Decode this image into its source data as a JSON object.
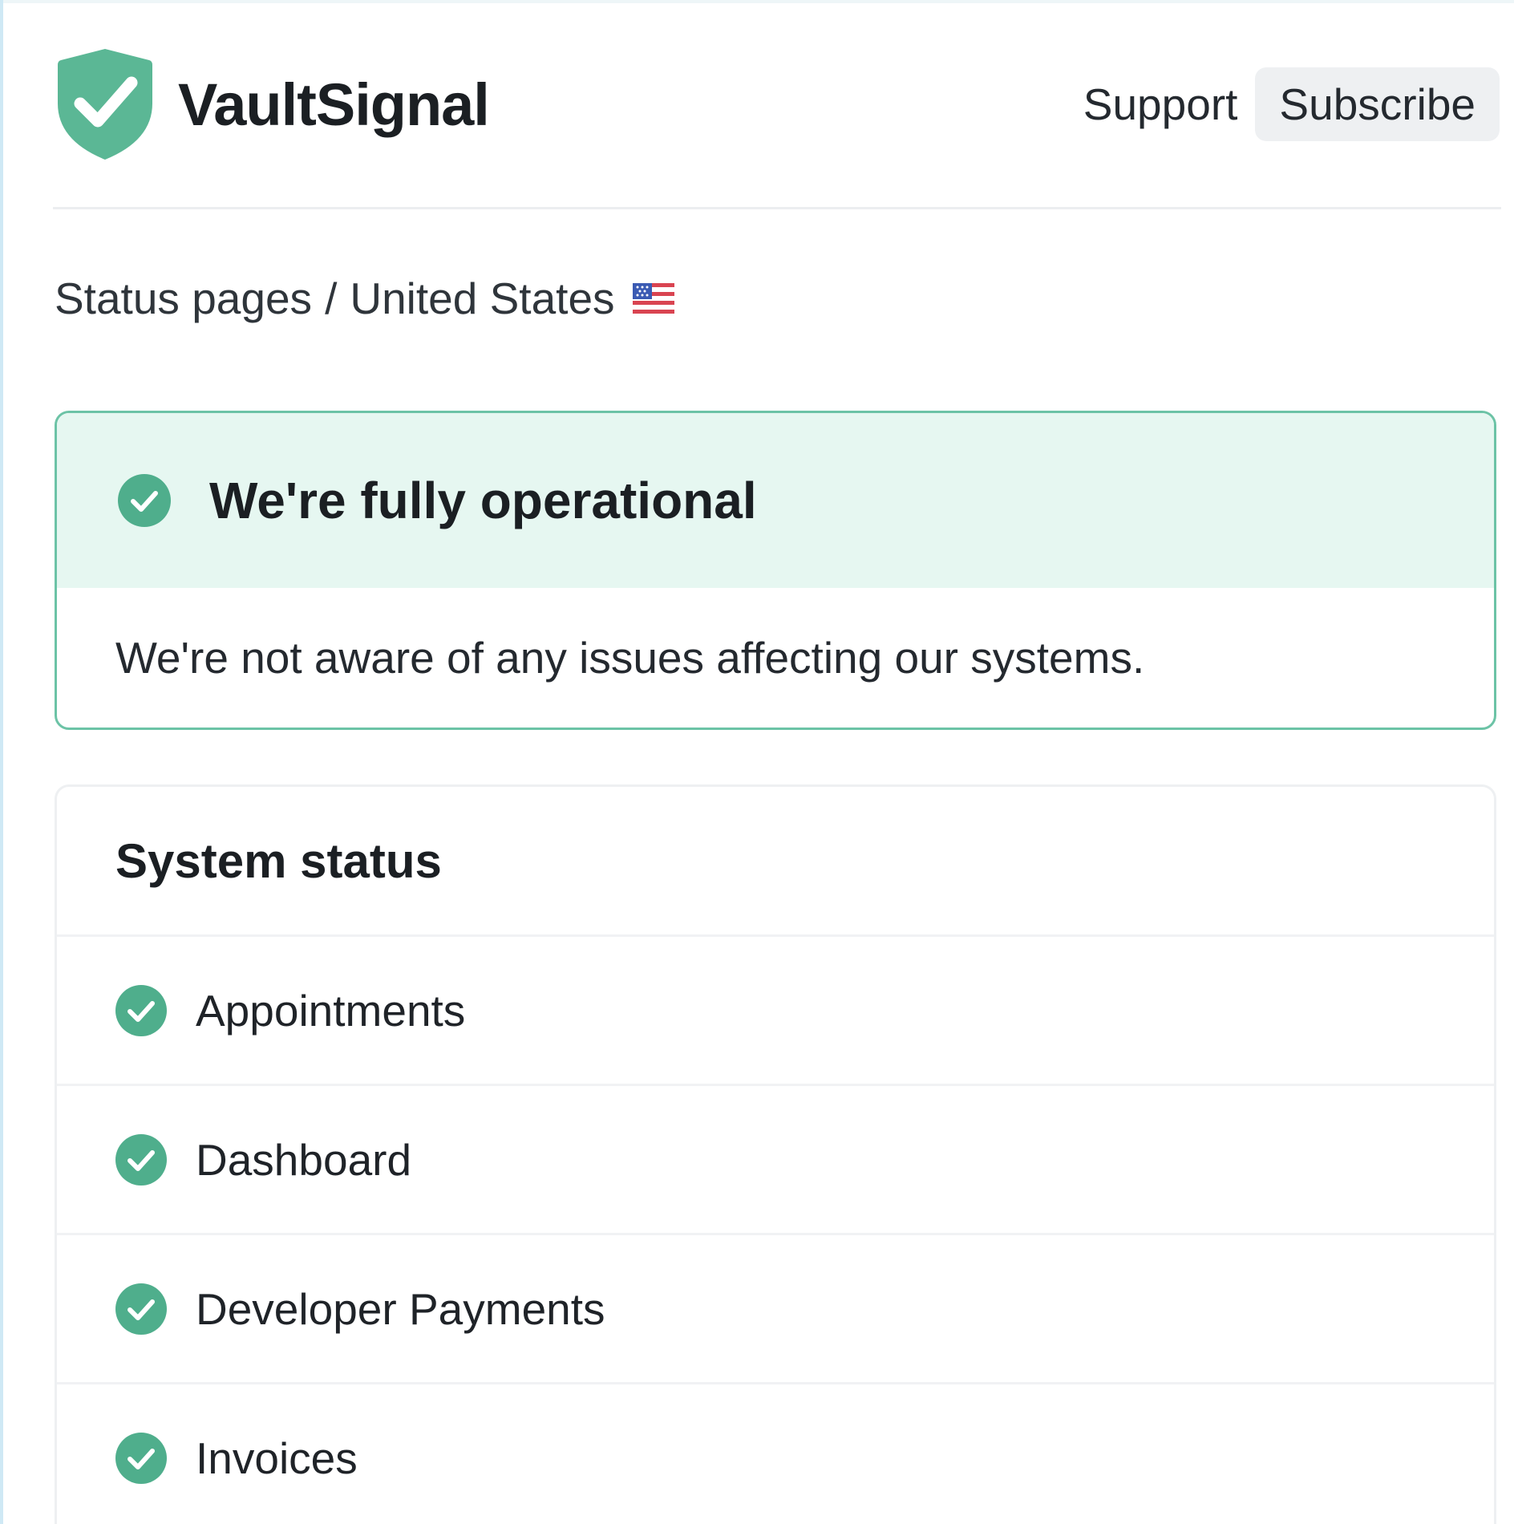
{
  "brand": {
    "name": "VaultSignal",
    "logo_icon": "shield-check-icon",
    "accent_color": "#5bb795"
  },
  "nav": {
    "support_label": "Support",
    "subscribe_label": "Subscribe"
  },
  "breadcrumb": {
    "root": "Status pages",
    "separator": "/",
    "current": "United States",
    "flag_icon": "us-flag-icon"
  },
  "status": {
    "title": "We're fully operational",
    "message": "We're not aware of any issues affecting our systems.",
    "state": "operational",
    "icon": "check-circle-icon"
  },
  "system_status": {
    "title": "System status",
    "components": [
      {
        "name": "Appointments",
        "state": "operational",
        "icon": "check-circle-icon"
      },
      {
        "name": "Dashboard",
        "state": "operational",
        "icon": "check-circle-icon"
      },
      {
        "name": "Developer Payments",
        "state": "operational",
        "icon": "check-circle-icon"
      },
      {
        "name": "Invoices",
        "state": "operational",
        "icon": "check-circle-icon"
      }
    ]
  }
}
